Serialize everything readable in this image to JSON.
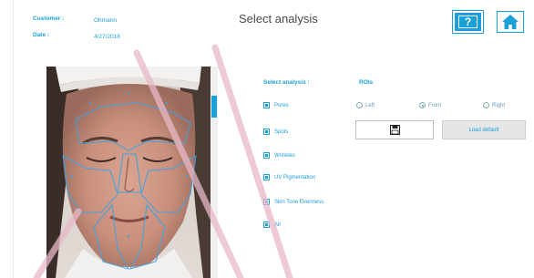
{
  "customer": {
    "customer_label": "Customer :",
    "customer_value": "Ohmann",
    "date_label": "Date :",
    "date_value": "4/27/2018"
  },
  "header": {
    "title": "Select analysis",
    "help_label": "?",
    "icons": [
      "help-icon",
      "home-icon"
    ]
  },
  "analysis": {
    "heading": "Select analysis :",
    "options": [
      {
        "label": "Pores",
        "checked": true
      },
      {
        "label": "Spots",
        "checked": true
      },
      {
        "label": "Wrinkles",
        "checked": true
      },
      {
        "label": "UV Pigmentation",
        "checked": true
      },
      {
        "label": "Skin Tone Evenness",
        "checked": true
      },
      {
        "label": "All",
        "checked": true
      }
    ]
  },
  "rois": {
    "heading": "ROIs",
    "options": [
      {
        "label": "Left",
        "selected": false
      },
      {
        "label": "Front",
        "selected": true
      },
      {
        "label": "Right",
        "selected": false
      }
    ],
    "save_icon": "floppy-disk-icon",
    "load_default_label": "Load default"
  },
  "colors": {
    "accent": "#1a9fd6",
    "watermark": "#e8b9c8"
  }
}
